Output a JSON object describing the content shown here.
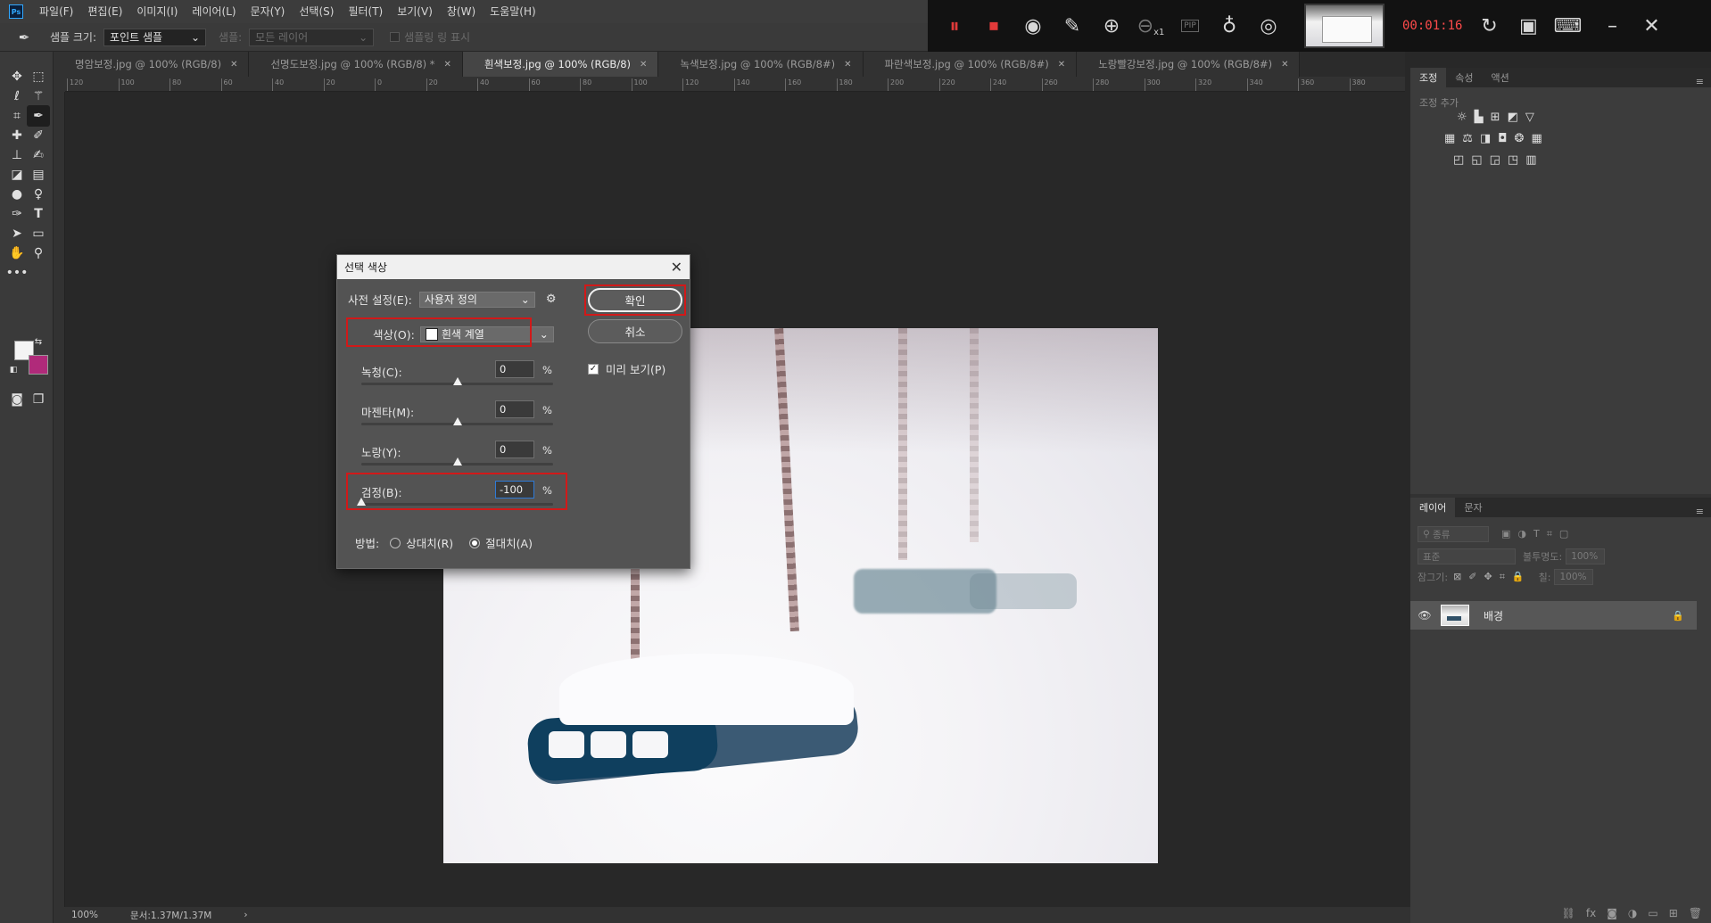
{
  "menubar": {
    "items": [
      "파일(F)",
      "편집(E)",
      "이미지(I)",
      "레이어(L)",
      "문자(Y)",
      "선택(S)",
      "필터(T)",
      "보기(V)",
      "창(W)",
      "도움말(H)"
    ]
  },
  "recorder": {
    "timer": "00:01:16",
    "zoom_label": "x1",
    "pip_label": "PIP"
  },
  "optbar": {
    "sample_size_label": "샘플 크기:",
    "sample_size_value": "포인트 샘플",
    "sample_label": "샘플:",
    "sample_value": "모든 레이어",
    "show_ring_label": "샘플링 링 표시"
  },
  "tabs": [
    {
      "label": "명암보정.jpg @ 100% (RGB/8)",
      "active": false
    },
    {
      "label": "선명도보정.jpg @ 100% (RGB/8) *",
      "active": false
    },
    {
      "label": "흰색보정.jpg @ 100% (RGB/8)",
      "active": true
    },
    {
      "label": "녹색보정.jpg @ 100% (RGB/8#)",
      "active": false
    },
    {
      "label": "파란색보정.jpg @ 100% (RGB/8#)",
      "active": false
    },
    {
      "label": "노랑빨강보정.jpg @ 100% (RGB/8#)",
      "active": false
    }
  ],
  "ruler_ticks": [
    "120",
    "100",
    "80",
    "60",
    "40",
    "20",
    "0",
    "20",
    "40",
    "60",
    "80",
    "100",
    "120",
    "140",
    "160",
    "180",
    "200",
    "220",
    "240",
    "260",
    "280",
    "300",
    "320",
    "340",
    "360",
    "380"
  ],
  "dialog": {
    "title": "선택 색상",
    "preset_label": "사전 설정(E):",
    "preset_value": "사용자 정의",
    "colors_label": "색상(O):",
    "colors_value": "흰색 계열",
    "cyan_label": "녹청(C):",
    "cyan_value": "0",
    "magenta_label": "마젠타(M):",
    "magenta_value": "0",
    "yellow_label": "노랑(Y):",
    "yellow_value": "0",
    "black_label": "검정(B):",
    "black_value": "-100",
    "percent": "%",
    "method_label": "방법:",
    "relative_label": "상대치(R)",
    "absolute_label": "절대치(A)",
    "ok_label": "확인",
    "cancel_label": "취소",
    "preview_label": "미리 보기(P)",
    "slider_levels": {
      "cyan": 0,
      "magenta": 0,
      "yellow": 0,
      "black": -100
    }
  },
  "adjustments_panel": {
    "tabs": [
      "조정",
      "속성",
      "액션"
    ],
    "add_label": "조정 추가"
  },
  "layers_panel": {
    "tabs": [
      "레이어",
      "문자"
    ],
    "filter_label": "종류",
    "blend_mode": "표준",
    "opacity_label": "불투명도:",
    "opacity_value": "100%",
    "lock_label": "잠그기:",
    "fill_label": "칠:",
    "fill_value": "100%",
    "layer_name": "배경"
  },
  "status": {
    "zoom": "100%",
    "doc": "문서:1.37M/1.37M"
  },
  "colors": {
    "foreground": "#f4f4f4",
    "background": "#b02a7a",
    "highlight_box": "#d11919",
    "timer": "#ff4b4b"
  }
}
